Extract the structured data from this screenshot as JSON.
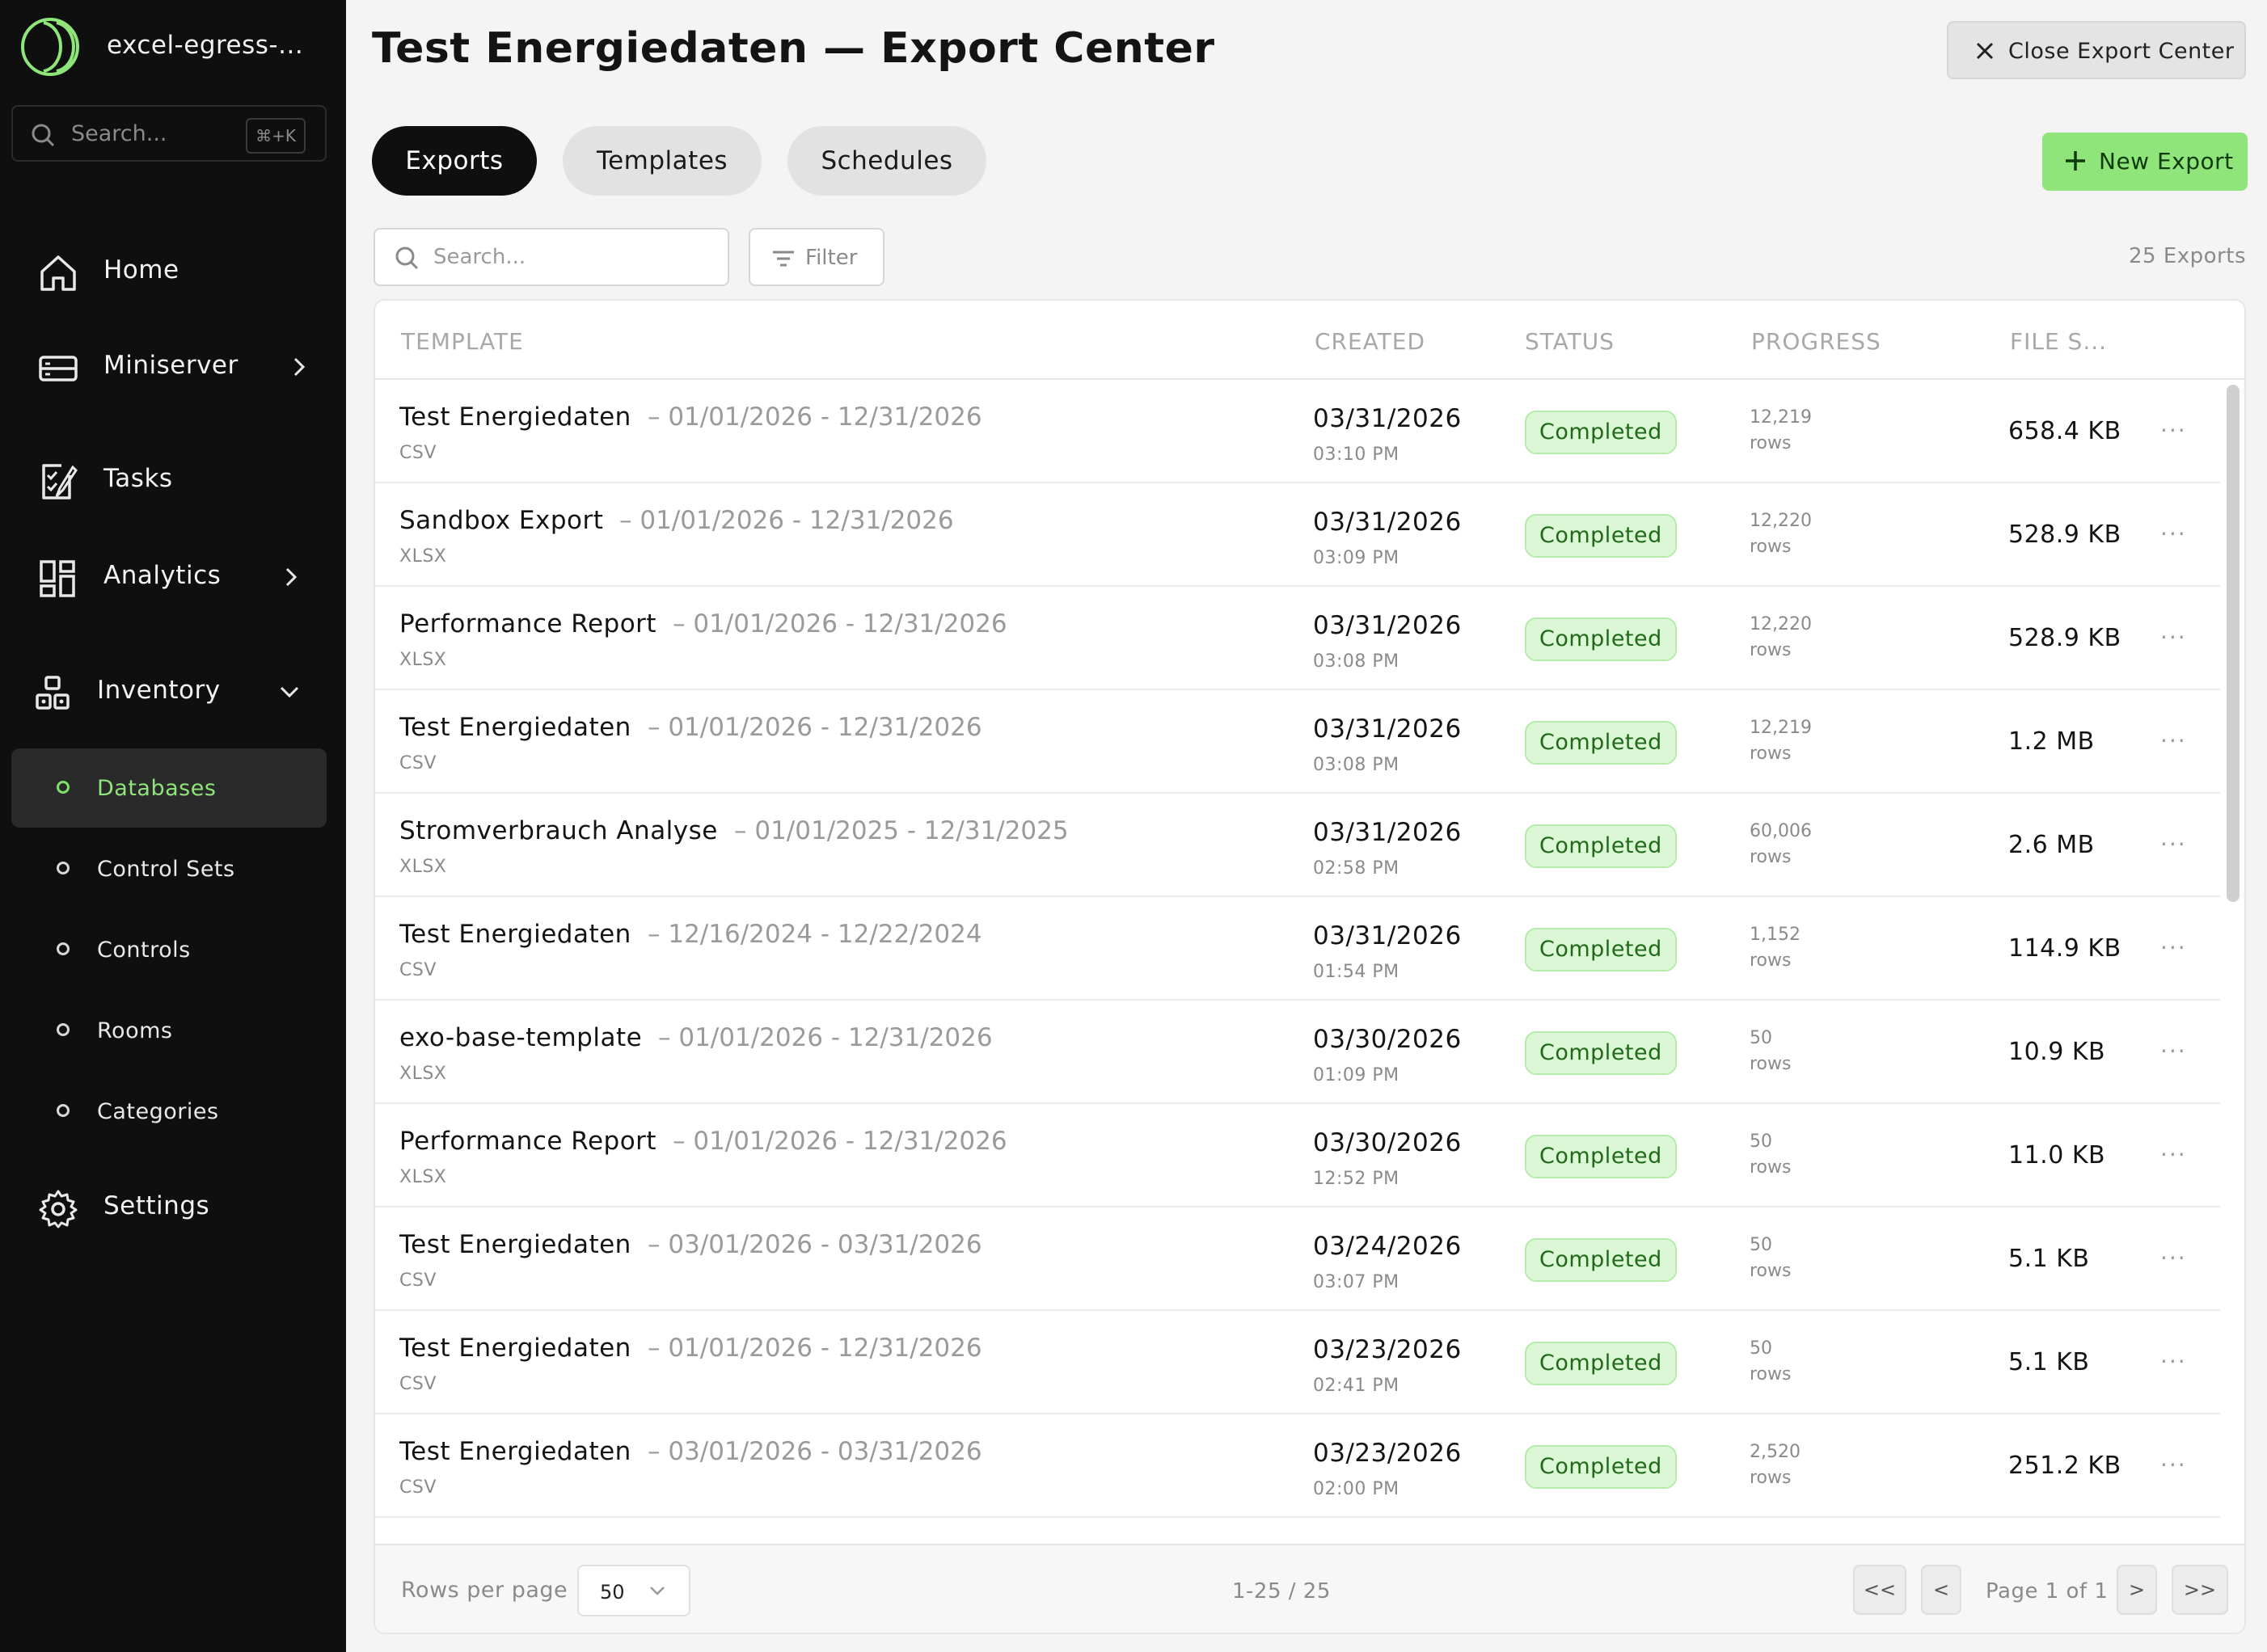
{
  "sidebar": {
    "app_name": "excel-egress-...",
    "search_placeholder": "Search...",
    "search_shortcut": "⌘+K",
    "nav": [
      {
        "label": "Home"
      },
      {
        "label": "Miniserver"
      },
      {
        "label": "Tasks"
      },
      {
        "label": "Analytics"
      },
      {
        "label": "Inventory"
      }
    ],
    "inventory_items": [
      {
        "label": "Databases",
        "active": true
      },
      {
        "label": "Control Sets"
      },
      {
        "label": "Controls"
      },
      {
        "label": "Rooms"
      },
      {
        "label": "Categories"
      }
    ],
    "settings_label": "Settings"
  },
  "header": {
    "title": "Test Energiedaten — Export Center",
    "close_label": "Close Export Center"
  },
  "tabs": [
    {
      "label": "Exports",
      "active": true
    },
    {
      "label": "Templates"
    },
    {
      "label": "Schedules"
    }
  ],
  "new_export_label": "New Export",
  "toolbar": {
    "search_placeholder": "Search...",
    "filter_label": "Filter",
    "count_label": "25 Exports"
  },
  "table": {
    "columns": [
      "TEMPLATE",
      "CREATED",
      "STATUS",
      "PROGRESS",
      "FILE S..."
    ],
    "rows": [
      {
        "name": "Test Energiedaten",
        "range": "– 01/01/2026 - 12/31/2026",
        "format": "CSV",
        "date": "03/31/2026",
        "time": "03:10 PM",
        "status": "Completed",
        "rows_count": "12,219",
        "rows_unit": "rows",
        "size": "658.4 KB"
      },
      {
        "name": "Sandbox Export",
        "range": "– 01/01/2026 - 12/31/2026",
        "format": "XLSX",
        "date": "03/31/2026",
        "time": "03:09 PM",
        "status": "Completed",
        "rows_count": "12,220",
        "rows_unit": "rows",
        "size": "528.9 KB"
      },
      {
        "name": "Performance Report",
        "range": "– 01/01/2026 - 12/31/2026",
        "format": "XLSX",
        "date": "03/31/2026",
        "time": "03:08 PM",
        "status": "Completed",
        "rows_count": "12,220",
        "rows_unit": "rows",
        "size": "528.9 KB"
      },
      {
        "name": "Test Energiedaten",
        "range": "– 01/01/2026 - 12/31/2026",
        "format": "CSV",
        "date": "03/31/2026",
        "time": "03:08 PM",
        "status": "Completed",
        "rows_count": "12,219",
        "rows_unit": "rows",
        "size": "1.2 MB"
      },
      {
        "name": "Stromverbrauch Analyse",
        "range": "– 01/01/2025 - 12/31/2025",
        "format": "XLSX",
        "date": "03/31/2026",
        "time": "02:58 PM",
        "status": "Completed",
        "rows_count": "60,006",
        "rows_unit": "rows",
        "size": "2.6 MB"
      },
      {
        "name": "Test Energiedaten",
        "range": "– 12/16/2024 - 12/22/2024",
        "format": "CSV",
        "date": "03/31/2026",
        "time": "01:54 PM",
        "status": "Completed",
        "rows_count": "1,152",
        "rows_unit": "rows",
        "size": "114.9 KB"
      },
      {
        "name": "exo-base-template",
        "range": "– 01/01/2026 - 12/31/2026",
        "format": "XLSX",
        "date": "03/30/2026",
        "time": "01:09 PM",
        "status": "Completed",
        "rows_count": "50",
        "rows_unit": "rows",
        "size": "10.9 KB"
      },
      {
        "name": "Performance Report",
        "range": "– 01/01/2026 - 12/31/2026",
        "format": "XLSX",
        "date": "03/30/2026",
        "time": "12:52 PM",
        "status": "Completed",
        "rows_count": "50",
        "rows_unit": "rows",
        "size": "11.0 KB"
      },
      {
        "name": "Test Energiedaten",
        "range": "– 03/01/2026 - 03/31/2026",
        "format": "CSV",
        "date": "03/24/2026",
        "time": "03:07 PM",
        "status": "Completed",
        "rows_count": "50",
        "rows_unit": "rows",
        "size": "5.1 KB"
      },
      {
        "name": "Test Energiedaten",
        "range": "– 01/01/2026 - 12/31/2026",
        "format": "CSV",
        "date": "03/23/2026",
        "time": "02:41 PM",
        "status": "Completed",
        "rows_count": "50",
        "rows_unit": "rows",
        "size": "5.1 KB"
      },
      {
        "name": "Test Energiedaten",
        "range": "– 03/01/2026 - 03/31/2026",
        "format": "CSV",
        "date": "03/23/2026",
        "time": "02:00 PM",
        "status": "Completed",
        "rows_count": "2,520",
        "rows_unit": "rows",
        "size": "251.2 KB"
      }
    ],
    "more_glyph": "···"
  },
  "pagination": {
    "rows_per_page_label": "Rows per page",
    "rows_per_page_value": "50",
    "range_label": "1-25 / 25",
    "first": "<<",
    "prev": "<",
    "page_label": "Page 1 of 1",
    "next": ">",
    "last": ">>"
  },
  "colors": {
    "accent": "#8fe57a",
    "sidebar_bg": "#0f0f0f",
    "status_completed_bg": "#dcf7d6",
    "status_completed_text": "#1e6a17"
  }
}
